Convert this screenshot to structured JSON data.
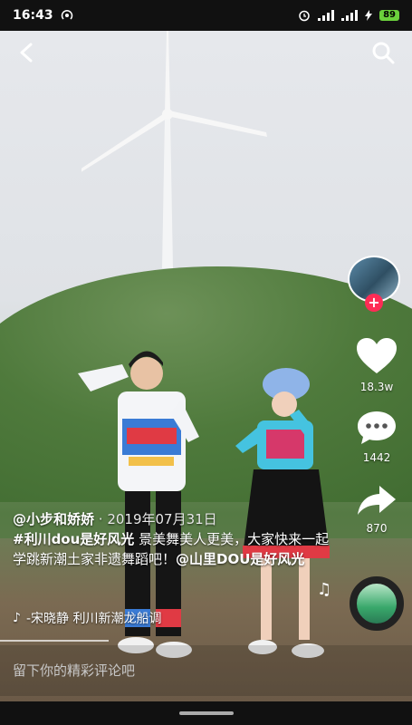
{
  "status_bar": {
    "time": "16:43",
    "battery": "89"
  },
  "icons": {
    "back": "chevron-left-icon",
    "search": "search-icon",
    "like": "heart-icon",
    "comment": "comment-icon",
    "share": "share-icon",
    "music": "music-note-icon",
    "tiktok": "tiktok-logo-icon"
  },
  "rail": {
    "likes": "18.3w",
    "comments": "1442",
    "shares": "870"
  },
  "caption": {
    "author": "@小步和娇娇",
    "date": " · 2019年07月31日",
    "hashtag": "#利川dou是好风光",
    "text": " 景美舞美人更美，大家快来一起学跳新潮土家非遗舞蹈吧！",
    "mention": "@山里DOU是好风光"
  },
  "music": {
    "title": "-宋晓静    利川新潮龙船调"
  },
  "comment_bar": {
    "placeholder": "留下你的精彩评论吧"
  },
  "colors": {
    "accent": "#fe2c55",
    "battery": "#6bd03c"
  }
}
